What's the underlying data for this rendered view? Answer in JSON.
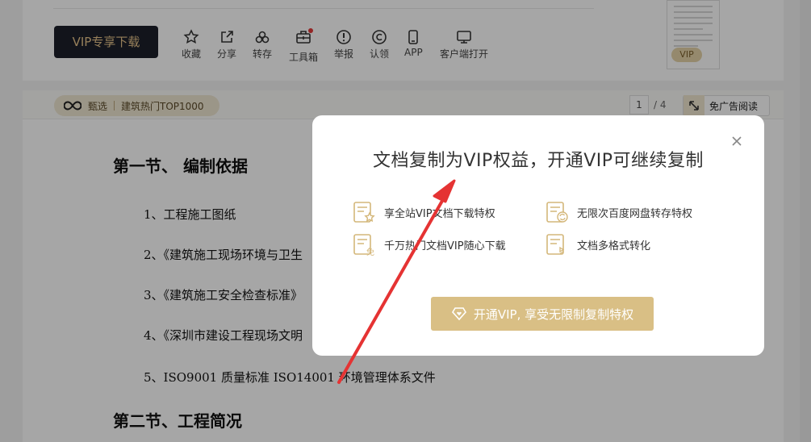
{
  "toolbar": {
    "vip_download": "VIP专享下载",
    "items": [
      {
        "label": "收藏",
        "icon": "star-icon"
      },
      {
        "label": "分享",
        "icon": "share-icon"
      },
      {
        "label": "转存",
        "icon": "cloud-save-icon"
      },
      {
        "label": "工具箱",
        "icon": "toolbox-icon"
      },
      {
        "label": "举报",
        "icon": "report-icon"
      },
      {
        "label": "认领",
        "icon": "copyright-icon"
      },
      {
        "label": "APP",
        "icon": "phone-icon"
      },
      {
        "label": "客户端打开",
        "icon": "monitor-icon"
      }
    ],
    "thumb_badge": "VIP"
  },
  "subbar": {
    "tag_prefix": "甄选",
    "tag_label": "建筑热门TOP1000",
    "page_current": "1",
    "page_total": "/ 4",
    "adfree_label": "免广告阅读"
  },
  "document": {
    "heading1": "第一节、   编制依据",
    "items": [
      "1、工程施工图纸",
      "2、《建筑施工现场环境与卫生",
      "3、《建筑施工安全检查标准》",
      "4、《深圳市建设工程现场文明",
      "5、ISO9001 质量标准 ISO14001 环境管理体系文件"
    ],
    "heading2": "第二节、工程简况"
  },
  "modal": {
    "title": "文档复制为VIP权益，开通VIP可继续复制",
    "benefits": [
      "享全站VIP文档下载特权",
      "无限次百度网盘转存特权",
      "千万热门文档VIP随心下载",
      "文档多格式转化"
    ],
    "cta_label": "开通VIP, 享受无限制复制特权"
  },
  "colors": {
    "accent_gold": "#d9bf85",
    "dark_button": "#1c1f2a",
    "arrow_red": "#e53333"
  }
}
